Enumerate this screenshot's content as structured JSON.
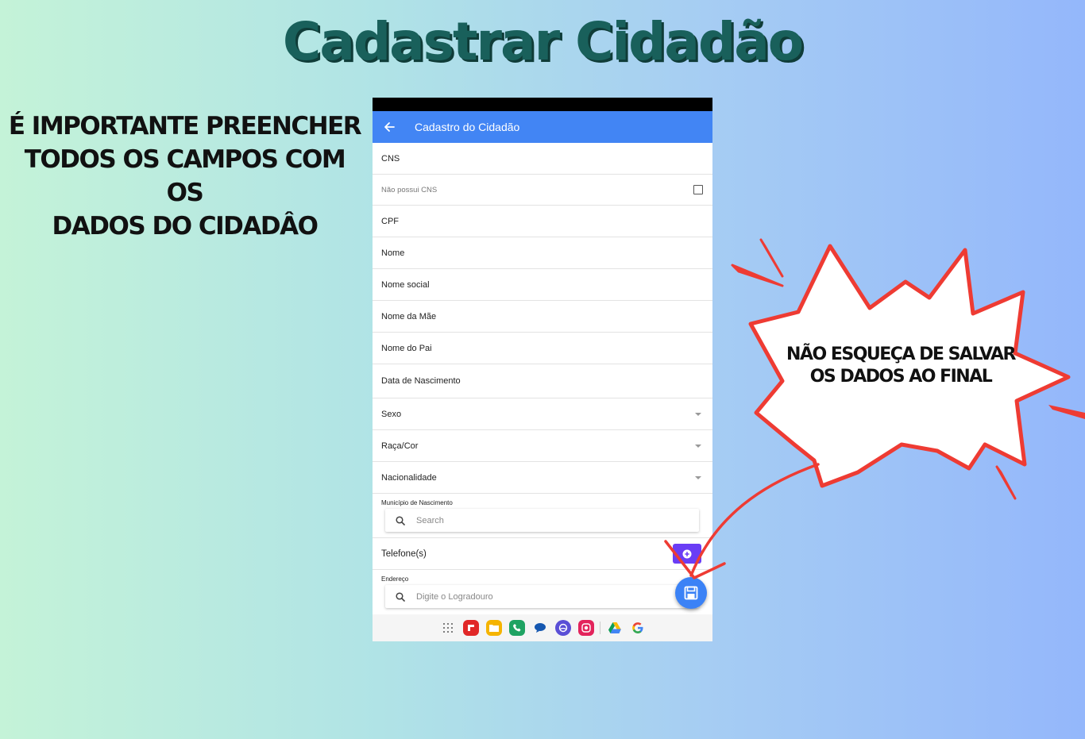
{
  "page": {
    "title": "Cadastrar Cidadão",
    "instruction_lines": [
      "É IMPORTANTE PREENCHER",
      "TODOS OS CAMPOS COM OS",
      "DADOS DO CIDADÂO"
    ],
    "callout_lines": [
      "NÃO ESQUEÇA DE SALVAR",
      "OS DADOS AO FINAL"
    ]
  },
  "app": {
    "title": "Cadastro do Cidadão",
    "back_icon": "arrow-left-icon",
    "accent_color": "#4285f4",
    "fields": {
      "cns": "CNS",
      "no_cns": "Não possui CNS",
      "cpf": "CPF",
      "nome": "Nome",
      "nome_social": "Nome social",
      "nome_mae": "Nome da Mãe",
      "nome_pai": "Nome do Pai",
      "data_nascimento": "Data de Nascimento",
      "sexo": "Sexo",
      "raca_cor": "Raça/Cor",
      "nacionalidade": "Nacionalidade",
      "municipio_label": "Município de Nascimento",
      "municipio_placeholder": "Search",
      "telefones": "Telefone(s)",
      "endereco_label": "Endereço",
      "endereco_placeholder": "Digite o Logradouro"
    },
    "icons": {
      "checkbox": "checkbox-icon",
      "dropdown": "caret-down-icon",
      "search": "search-icon",
      "add_phone": "plus-circle-icon",
      "save": "save-icon"
    },
    "add_button_color": "#6a3df5",
    "save_button_color": "#3b82f6"
  },
  "taskbar": {
    "apps": [
      "app-grid-icon",
      "flipboard-icon",
      "files-icon",
      "phone-icon",
      "messages-icon",
      "internet-icon",
      "screen-recorder-icon",
      "drive-icon",
      "google-icon"
    ]
  },
  "colors": {
    "title": "#19605b",
    "callout_stroke": "#ee3b33"
  }
}
